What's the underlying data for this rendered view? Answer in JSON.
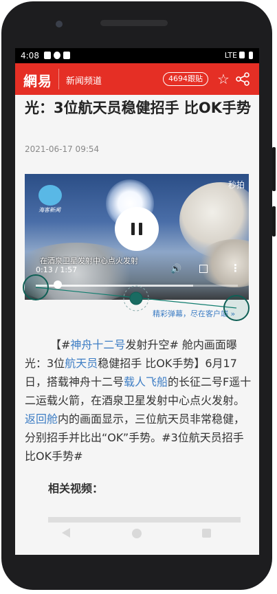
{
  "status_bar": {
    "time": "4:08",
    "network": "LTE"
  },
  "app_bar": {
    "logo": "網易",
    "channel": "新闻频道",
    "follow_count": "4694跟贴",
    "favorite_icon": "star-icon",
    "share_icon": "share-icon"
  },
  "article": {
    "title": "光：3位航天员稳健招手 比OK手势",
    "date": "2021-06-17 09:54"
  },
  "video": {
    "source_logo_text": "海客新闻",
    "watermark": "秒拍",
    "caption": "在酒泉卫星发射中心点火发射",
    "time_current": "0:13",
    "time_total": "1:57",
    "timecode": "0:13 / 1:57",
    "progress": 0.11,
    "buffered": 0.78
  },
  "barrage_link": "精彩弹幕，尽在客户端 »",
  "body": {
    "p1": [
      "【#",
      "神舟十二号",
      "发射升空# 舱内画面曝光：3位",
      "航天员",
      "稳健招手 比OK手势】6月17日，搭载神舟十二号",
      "载人飞船",
      "的长征二号F遥十二运载火箭，在酒泉卫星发射中心点火发射。",
      "返回舱",
      "内的画面显示，三位航天员非常稳健，分别招手并比出“OK”手势。#3位航天员招手比OK手势#"
    ]
  },
  "related_heading": "相关视频："
}
